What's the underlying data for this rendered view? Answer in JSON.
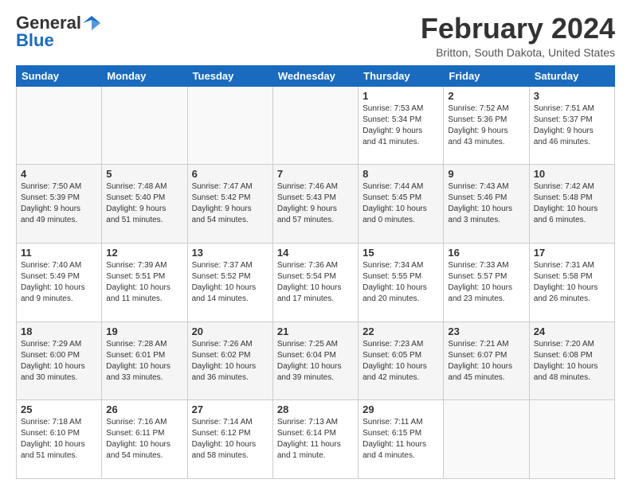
{
  "header": {
    "logo_line1": "General",
    "logo_line2": "Blue",
    "month_title": "February 2024",
    "location": "Britton, South Dakota, United States"
  },
  "days_of_week": [
    "Sunday",
    "Monday",
    "Tuesday",
    "Wednesday",
    "Thursday",
    "Friday",
    "Saturday"
  ],
  "weeks": [
    [
      {
        "day": "",
        "info": ""
      },
      {
        "day": "",
        "info": ""
      },
      {
        "day": "",
        "info": ""
      },
      {
        "day": "",
        "info": ""
      },
      {
        "day": "1",
        "info": "Sunrise: 7:53 AM\nSunset: 5:34 PM\nDaylight: 9 hours\nand 41 minutes."
      },
      {
        "day": "2",
        "info": "Sunrise: 7:52 AM\nSunset: 5:36 PM\nDaylight: 9 hours\nand 43 minutes."
      },
      {
        "day": "3",
        "info": "Sunrise: 7:51 AM\nSunset: 5:37 PM\nDaylight: 9 hours\nand 46 minutes."
      }
    ],
    [
      {
        "day": "4",
        "info": "Sunrise: 7:50 AM\nSunset: 5:39 PM\nDaylight: 9 hours\nand 49 minutes."
      },
      {
        "day": "5",
        "info": "Sunrise: 7:48 AM\nSunset: 5:40 PM\nDaylight: 9 hours\nand 51 minutes."
      },
      {
        "day": "6",
        "info": "Sunrise: 7:47 AM\nSunset: 5:42 PM\nDaylight: 9 hours\nand 54 minutes."
      },
      {
        "day": "7",
        "info": "Sunrise: 7:46 AM\nSunset: 5:43 PM\nDaylight: 9 hours\nand 57 minutes."
      },
      {
        "day": "8",
        "info": "Sunrise: 7:44 AM\nSunset: 5:45 PM\nDaylight: 10 hours\nand 0 minutes."
      },
      {
        "day": "9",
        "info": "Sunrise: 7:43 AM\nSunset: 5:46 PM\nDaylight: 10 hours\nand 3 minutes."
      },
      {
        "day": "10",
        "info": "Sunrise: 7:42 AM\nSunset: 5:48 PM\nDaylight: 10 hours\nand 6 minutes."
      }
    ],
    [
      {
        "day": "11",
        "info": "Sunrise: 7:40 AM\nSunset: 5:49 PM\nDaylight: 10 hours\nand 9 minutes."
      },
      {
        "day": "12",
        "info": "Sunrise: 7:39 AM\nSunset: 5:51 PM\nDaylight: 10 hours\nand 11 minutes."
      },
      {
        "day": "13",
        "info": "Sunrise: 7:37 AM\nSunset: 5:52 PM\nDaylight: 10 hours\nand 14 minutes."
      },
      {
        "day": "14",
        "info": "Sunrise: 7:36 AM\nSunset: 5:54 PM\nDaylight: 10 hours\nand 17 minutes."
      },
      {
        "day": "15",
        "info": "Sunrise: 7:34 AM\nSunset: 5:55 PM\nDaylight: 10 hours\nand 20 minutes."
      },
      {
        "day": "16",
        "info": "Sunrise: 7:33 AM\nSunset: 5:57 PM\nDaylight: 10 hours\nand 23 minutes."
      },
      {
        "day": "17",
        "info": "Sunrise: 7:31 AM\nSunset: 5:58 PM\nDaylight: 10 hours\nand 26 minutes."
      }
    ],
    [
      {
        "day": "18",
        "info": "Sunrise: 7:29 AM\nSunset: 6:00 PM\nDaylight: 10 hours\nand 30 minutes."
      },
      {
        "day": "19",
        "info": "Sunrise: 7:28 AM\nSunset: 6:01 PM\nDaylight: 10 hours\nand 33 minutes."
      },
      {
        "day": "20",
        "info": "Sunrise: 7:26 AM\nSunset: 6:02 PM\nDaylight: 10 hours\nand 36 minutes."
      },
      {
        "day": "21",
        "info": "Sunrise: 7:25 AM\nSunset: 6:04 PM\nDaylight: 10 hours\nand 39 minutes."
      },
      {
        "day": "22",
        "info": "Sunrise: 7:23 AM\nSunset: 6:05 PM\nDaylight: 10 hours\nand 42 minutes."
      },
      {
        "day": "23",
        "info": "Sunrise: 7:21 AM\nSunset: 6:07 PM\nDaylight: 10 hours\nand 45 minutes."
      },
      {
        "day": "24",
        "info": "Sunrise: 7:20 AM\nSunset: 6:08 PM\nDaylight: 10 hours\nand 48 minutes."
      }
    ],
    [
      {
        "day": "25",
        "info": "Sunrise: 7:18 AM\nSunset: 6:10 PM\nDaylight: 10 hours\nand 51 minutes."
      },
      {
        "day": "26",
        "info": "Sunrise: 7:16 AM\nSunset: 6:11 PM\nDaylight: 10 hours\nand 54 minutes."
      },
      {
        "day": "27",
        "info": "Sunrise: 7:14 AM\nSunset: 6:12 PM\nDaylight: 10 hours\nand 58 minutes."
      },
      {
        "day": "28",
        "info": "Sunrise: 7:13 AM\nSunset: 6:14 PM\nDaylight: 11 hours\nand 1 minute."
      },
      {
        "day": "29",
        "info": "Sunrise: 7:11 AM\nSunset: 6:15 PM\nDaylight: 11 hours\nand 4 minutes."
      },
      {
        "day": "",
        "info": ""
      },
      {
        "day": "",
        "info": ""
      }
    ]
  ]
}
